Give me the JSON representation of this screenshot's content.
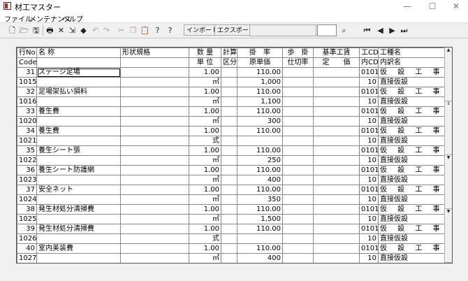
{
  "window": {
    "title": "材工マスター",
    "min": "—",
    "max": "☐",
    "close": "✕"
  },
  "menu": [
    "ファイル",
    "メンテナンス",
    "ヘルプ"
  ],
  "toolbar": {
    "import_label": "インポート",
    "export_label": "エクスポート",
    "search_value": ""
  },
  "headers": {
    "row1": [
      "行No",
      "名 称",
      "形状規格",
      "数 量",
      "計算",
      "掛　率",
      "歩　掛",
      "基準工賃",
      "工CD",
      "工種名"
    ],
    "row2": [
      "Code",
      "",
      "",
      "単 位",
      "区分",
      "原単価",
      "仕切率",
      "定　　価",
      "内CD",
      "内訳名"
    ]
  },
  "rows": [
    {
      "no": "31",
      "code": "1015",
      "name": "ステージ足場",
      "qty": "1.00",
      "unit": "㎡",
      "rate": "110.00",
      "price": "1,000",
      "kcd": "0101",
      "ncd": "10",
      "kname": "仮 設 工 事",
      "nname": "直接仮設"
    },
    {
      "no": "32",
      "code": "1016",
      "name": "足場架払い損料",
      "qty": "1.00",
      "unit": "㎡",
      "rate": "110.00",
      "price": "1,100",
      "kcd": "0101",
      "ncd": "10",
      "kname": "仮 設 工 事",
      "nname": "直接仮設"
    },
    {
      "no": "33",
      "code": "1020",
      "name": "養生費",
      "qty": "1.00",
      "unit": "㎡",
      "rate": "110.00",
      "price": "300",
      "kcd": "0101",
      "ncd": "10",
      "kname": "仮 設 工 事",
      "nname": "直接仮設"
    },
    {
      "no": "34",
      "code": "1021",
      "name": "養生費",
      "qty": "1.00",
      "unit": "式",
      "rate": "110.00",
      "price": "",
      "kcd": "0101",
      "ncd": "10",
      "kname": "仮 設 工 事",
      "nname": "直接仮設"
    },
    {
      "no": "35",
      "code": "1022",
      "name": "養生シート張",
      "qty": "1.00",
      "unit": "㎡",
      "rate": "110.00",
      "price": "250",
      "kcd": "0101",
      "ncd": "10",
      "kname": "仮 設 工 事",
      "nname": "直接仮設"
    },
    {
      "no": "36",
      "code": "1023",
      "name": "養生シート防護網",
      "qty": "1.00",
      "unit": "㎡",
      "rate": "110.00",
      "price": "400",
      "kcd": "0101",
      "ncd": "10",
      "kname": "仮 設 工 事",
      "nname": "直接仮設"
    },
    {
      "no": "37",
      "code": "1024",
      "name": "安全ネット",
      "qty": "1.00",
      "unit": "㎡",
      "rate": "110.00",
      "price": "350",
      "kcd": "0101",
      "ncd": "10",
      "kname": "仮 設 工 事",
      "nname": "直接仮設"
    },
    {
      "no": "38",
      "code": "1025",
      "name": "発生材処分清掃費",
      "qty": "1.00",
      "unit": "㎡",
      "rate": "110.00",
      "price": "1,500",
      "kcd": "0101",
      "ncd": "10",
      "kname": "仮 設 工 事",
      "nname": "直接仮設"
    },
    {
      "no": "39",
      "code": "1026",
      "name": "発生材処分清掃費",
      "qty": "1.00",
      "unit": "式",
      "rate": "110.00",
      "price": "",
      "kcd": "0101",
      "ncd": "10",
      "kname": "仮 設 工 事",
      "nname": "直接仮設"
    },
    {
      "no": "40",
      "code": "1027",
      "name": "室内美装費",
      "qty": "1.00",
      "unit": "㎡",
      "rate": "110.00",
      "price": "400",
      "kcd": "0101",
      "ncd": "10",
      "kname": "仮 設 工 事",
      "nname": "直接仮設"
    }
  ]
}
